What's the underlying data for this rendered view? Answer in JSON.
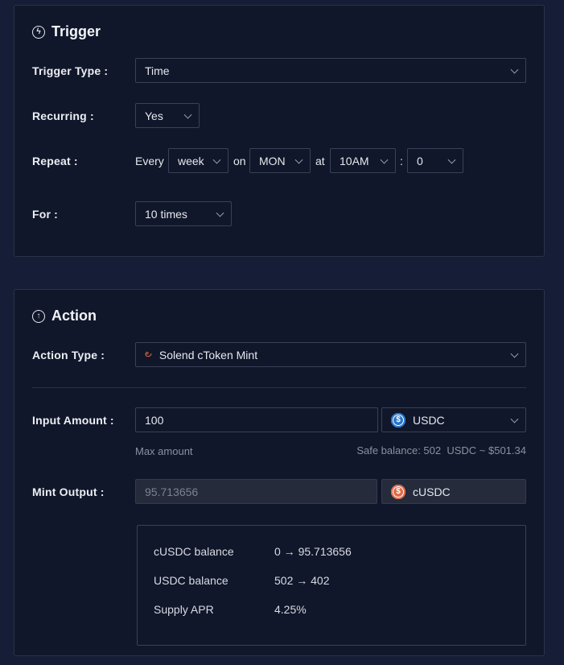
{
  "trigger": {
    "title": "Trigger",
    "type_label": "Trigger Type",
    "type_value": "Time",
    "recurring_label": "Recurring",
    "recurring_value": "Yes",
    "repeat_label": "Repeat",
    "repeat_every": "Every",
    "repeat_unit": "week",
    "repeat_on": "on",
    "repeat_day": "MON",
    "repeat_at": "at",
    "repeat_hour": "10AM",
    "repeat_sep": ":",
    "repeat_minute": "0",
    "for_label": "For",
    "for_value": "10 times"
  },
  "action": {
    "title": "Action",
    "type_label": "Action Type",
    "type_value": "Solend cToken Mint",
    "input_label": "Input Amount",
    "input_value": "100",
    "input_token": "USDC",
    "max_amount": "Max amount",
    "safe_balance": "Safe balance: 502  USDC ~ $501.34",
    "mint_label": "Mint Output",
    "mint_value": "95.713656",
    "mint_token": "cUSDC",
    "summary": [
      {
        "label": "cUSDC balance",
        "value": "0 → 95.713656"
      },
      {
        "label": "USDC balance",
        "value": "502 → 402"
      },
      {
        "label": "Supply APR",
        "value": "4.25%"
      }
    ]
  },
  "colon": ":",
  "icons": {
    "trigger": "lightning-circle-icon",
    "action": "arrow-up-circle-icon",
    "solend": "solend-logo-icon",
    "usdc": "usdc-coin-icon",
    "cusdc": "cusdc-coin-icon"
  },
  "colors": {
    "background": "#161d36",
    "card": "#10172a",
    "border": "#3a4157",
    "usdc": "#2775ca",
    "cusdc": "#e06a48"
  }
}
